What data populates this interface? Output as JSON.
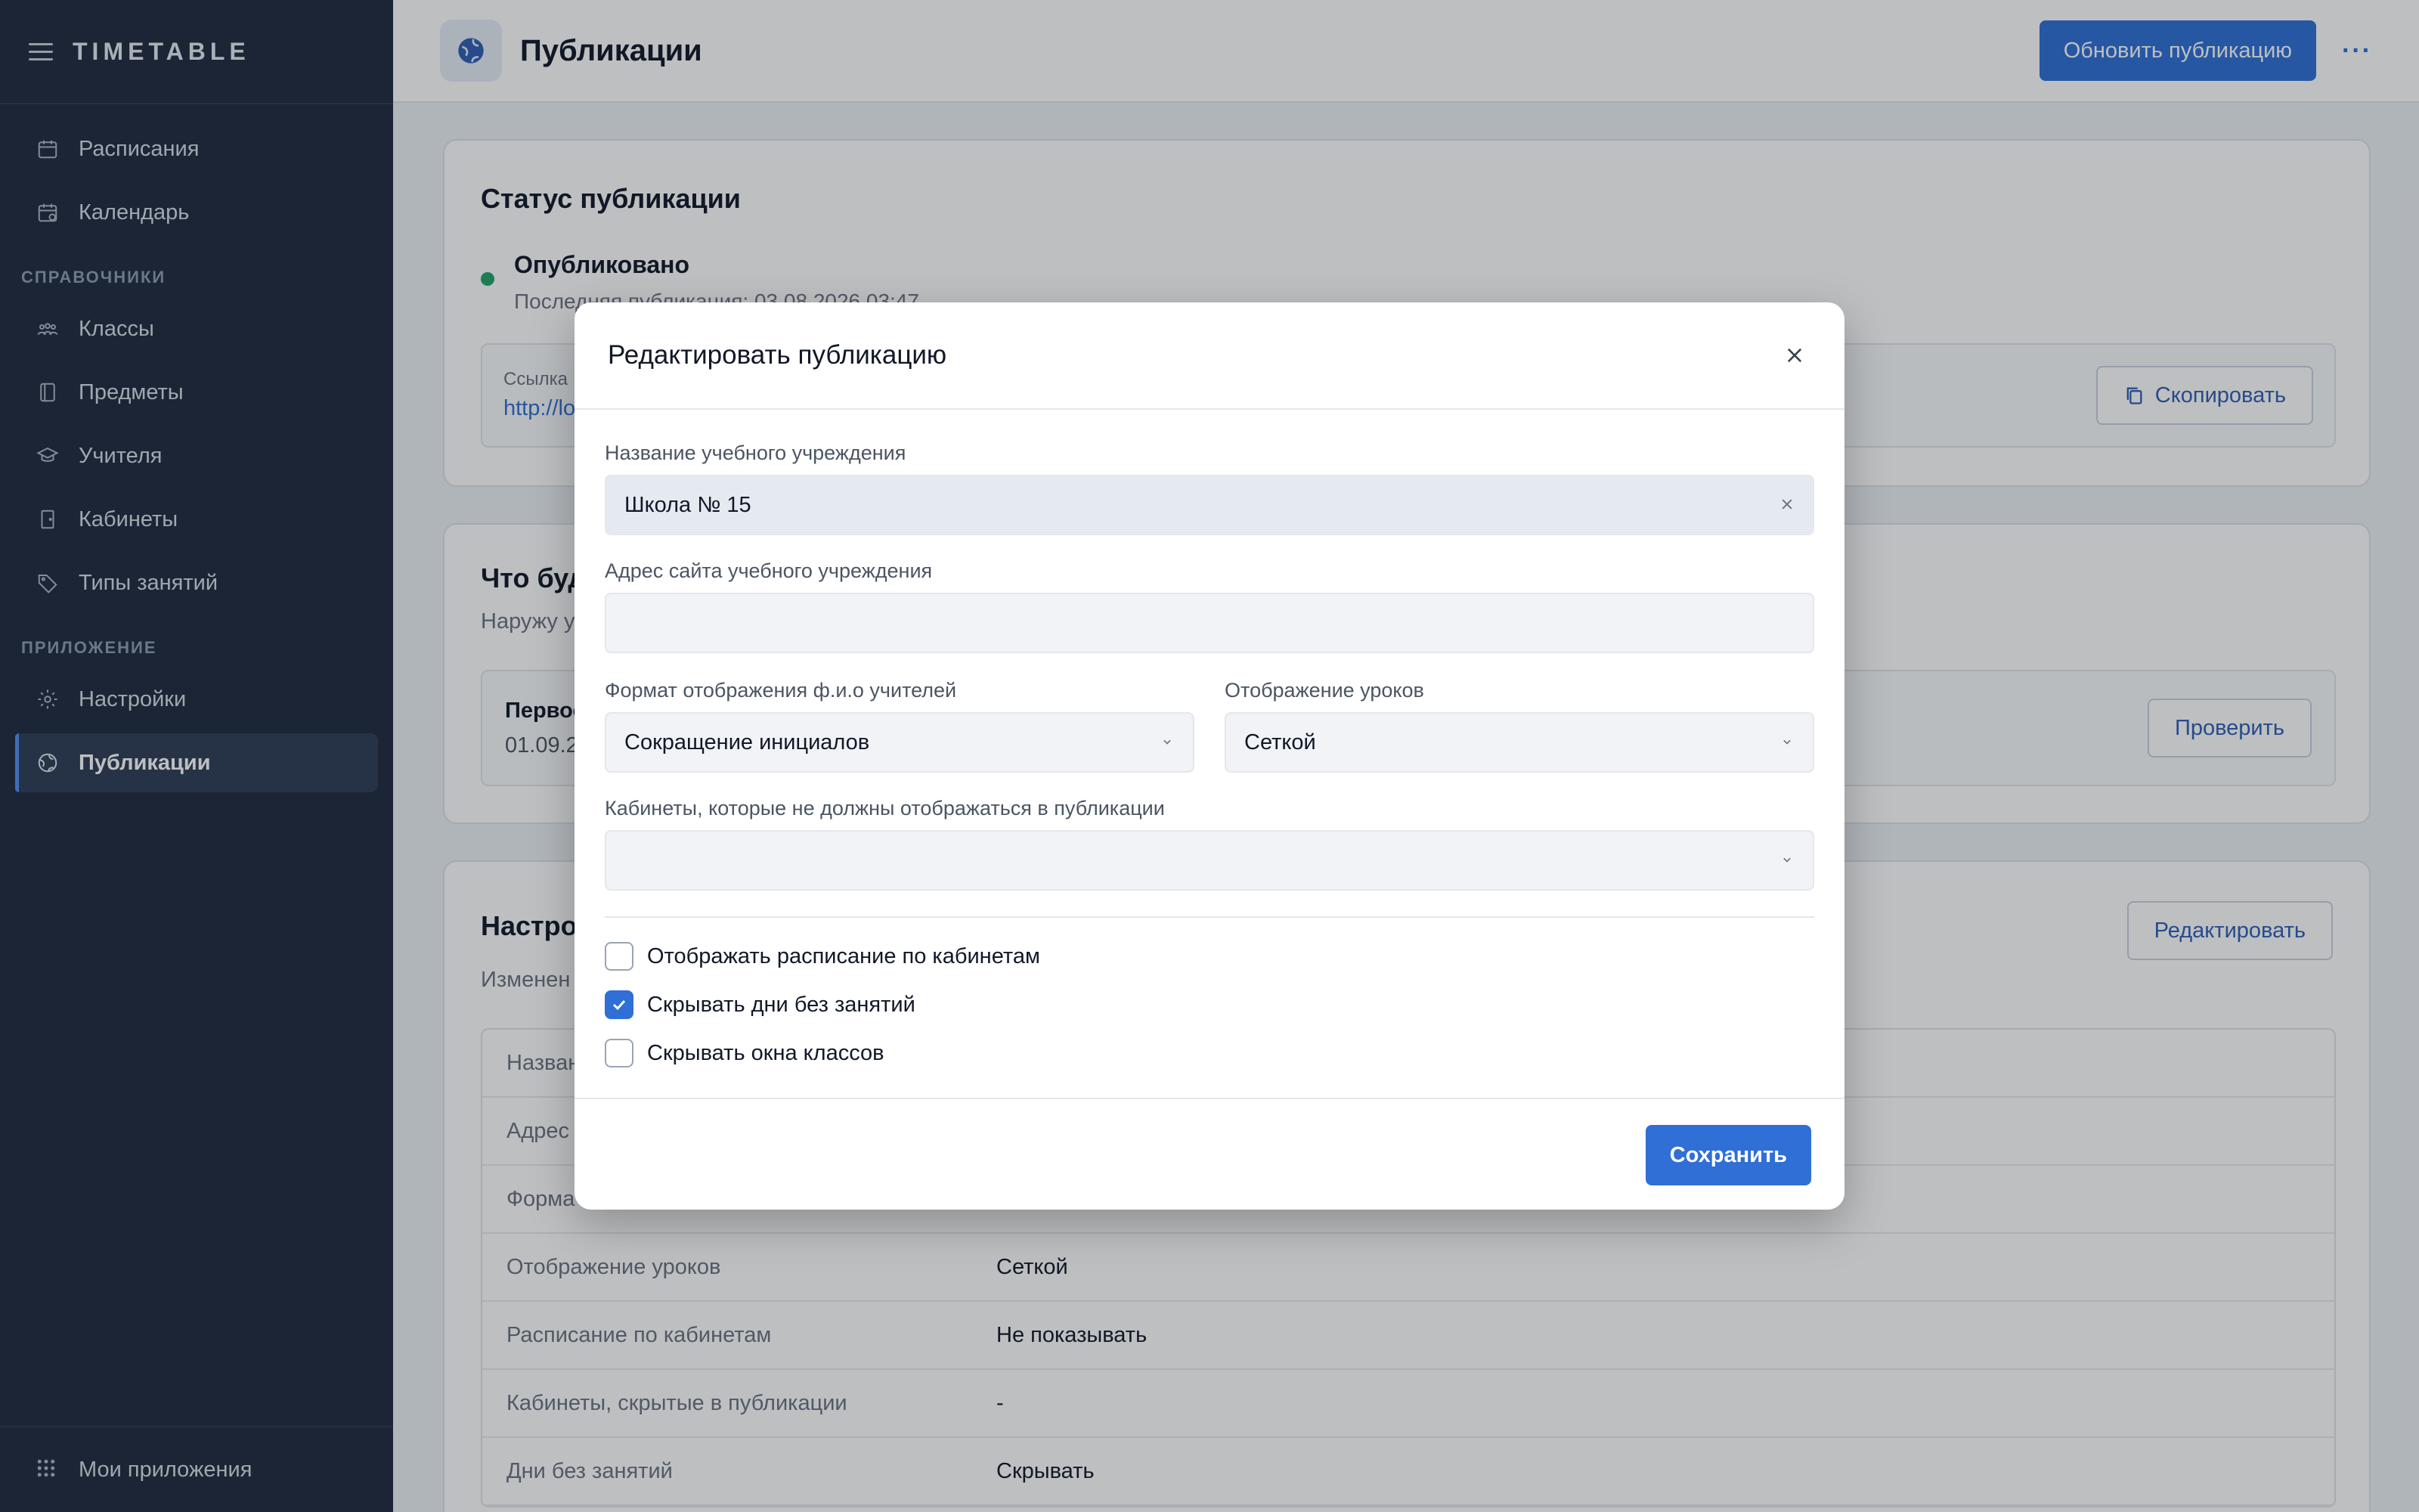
{
  "app": {
    "brand": "TIMETABLE"
  },
  "sidebar": {
    "items_top": [
      {
        "label": "Расписания",
        "icon": "calendar-icon"
      },
      {
        "label": "Календарь",
        "icon": "calendar-clock-icon"
      }
    ],
    "section_refs": "СПРАВОЧНИКИ",
    "items_refs": [
      {
        "label": "Классы",
        "icon": "people-icon"
      },
      {
        "label": "Предметы",
        "icon": "book-icon"
      },
      {
        "label": "Учителя",
        "icon": "graduation-cap-icon"
      },
      {
        "label": "Кабинеты",
        "icon": "door-icon"
      },
      {
        "label": "Типы занятий",
        "icon": "tag-icon"
      }
    ],
    "section_app": "ПРИЛОЖЕНИЕ",
    "items_app": [
      {
        "label": "Настройки",
        "icon": "gear-icon"
      },
      {
        "label": "Публикации",
        "icon": "globe-icon",
        "active": true
      }
    ],
    "footer": "Мои приложения"
  },
  "header": {
    "title": "Публикации",
    "update_button": "Обновить публикацию",
    "more": "···"
  },
  "status_card": {
    "title": "Статус публикации",
    "status": "Опубликовано",
    "last_published": "Последняя публикация: 03.08.2026 03:47",
    "link_label": "Ссылка",
    "link_url": "http://lo",
    "copy_button": "Скопировать"
  },
  "preview_card": {
    "title": "Что буд",
    "subtitle": "Наружу у",
    "item_title": "Первос",
    "item_date": "01.09.2",
    "check_button": "Проверить"
  },
  "settings_card": {
    "title": "Настро",
    "subtitle": "Изменен",
    "edit_button": "Редактировать",
    "rows": [
      {
        "key": "Назван",
        "value": ""
      },
      {
        "key": "Адрес",
        "value": ""
      },
      {
        "key": "Форма",
        "value": ""
      },
      {
        "key": "Отображение уроков",
        "value": "Сеткой"
      },
      {
        "key": "Расписание по кабинетам",
        "value": "Не показывать"
      },
      {
        "key": "Кабинеты, скрытые в публикации",
        "value": "-"
      },
      {
        "key": "Дни без занятий",
        "value": "Скрывать"
      }
    ]
  },
  "modal": {
    "title": "Редактировать публикацию",
    "name_label": "Название учебного учреждения",
    "name_value": "Школа № 15",
    "site_label": "Адрес сайта учебного учреждения",
    "site_value": "",
    "teacher_format_label": "Формат отображения ф.и.о учителей",
    "teacher_format_value": "Сокращение инициалов",
    "lessons_label": "Отображение уроков",
    "lessons_value": "Сеткой",
    "rooms_label": "Кабинеты, которые не должны отображаться в публикации",
    "rooms_value": "",
    "checkboxes": [
      {
        "label": "Отображать расписание по кабинетам",
        "checked": false
      },
      {
        "label": "Скрывать дни без занятий",
        "checked": true
      },
      {
        "label": "Скрывать окна классов",
        "checked": false
      }
    ],
    "save_button": "Сохранить"
  },
  "colors": {
    "primary": "#2f6fd6",
    "sidebar": "#1f2a3d",
    "success": "#1fa463"
  }
}
